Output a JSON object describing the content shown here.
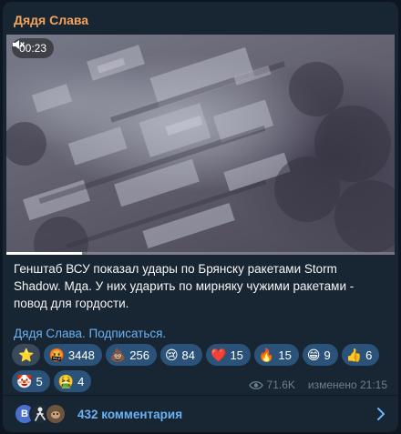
{
  "post": {
    "channel_name": "Дядя Слава",
    "video": {
      "timestamp": "00:23",
      "muted_icon": "speaker-muted-icon",
      "progress": 0.195
    },
    "text": "Генштаб ВСУ показал удары по Брянску ракетами Storm Shadow. Мда. У них ударить по мирняку чужими ракетами - повод для гордости.",
    "subscribe_line": "Дядя Слава. Подписаться.",
    "reactions": [
      {
        "emoji": "⭐",
        "count": ""
      },
      {
        "emoji": "🤬",
        "count": "3448"
      },
      {
        "emoji": "💩",
        "count": "256"
      },
      {
        "emoji": "😢",
        "count": "84"
      },
      {
        "emoji": "❤️",
        "count": "15"
      },
      {
        "emoji": "🔥",
        "count": "15"
      },
      {
        "emoji": "😁",
        "count": "9"
      },
      {
        "emoji": "👍",
        "count": "6"
      },
      {
        "emoji": "🤡",
        "count": "5"
      },
      {
        "emoji": "🤮",
        "count": "4"
      }
    ],
    "views": "71.6K",
    "edited_label": "изменено 21:15"
  },
  "comments": {
    "avatar_letter": "B",
    "label": "432 комментария"
  },
  "colors": {
    "background": "#0e1621",
    "bubble": "#182533",
    "channel_name": "#f2a35c",
    "link": "#6ab3f3",
    "reaction": "#2b5278"
  }
}
